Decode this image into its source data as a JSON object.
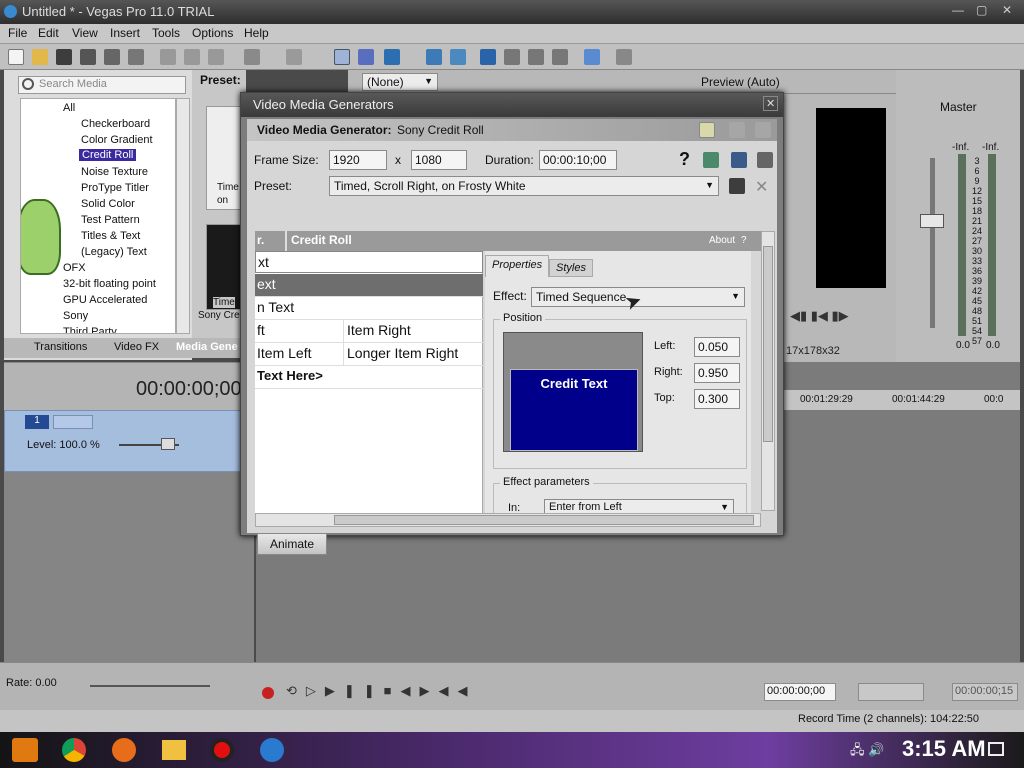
{
  "window": {
    "title": "Untitled * - Vegas Pro 11.0 TRIAL"
  },
  "menu": [
    "File",
    "Edit",
    "View",
    "Insert",
    "Tools",
    "Options",
    "Help"
  ],
  "explorer": {
    "search_placeholder": "Search Media",
    "preset_label": "Preset:",
    "tree": [
      "All",
      "Checkerboard",
      "Color Gradient",
      "Credit Roll",
      "Noise Texture",
      "ProType Titler",
      "Solid Color",
      "Test Pattern",
      "Titles & Text",
      "(Legacy) Text",
      "OFX",
      "32-bit floating point",
      "GPU Accelerated",
      "Sony",
      "Third Party"
    ],
    "selected": "Credit Roll",
    "thumb1_caption": "Time\non",
    "thumb2_caption": "Time",
    "thumb2_sub": "Sony Cre"
  },
  "window_tabs": [
    "Transitions",
    "Video FX",
    "Media Gene"
  ],
  "preview": {
    "preset": "(None)",
    "quality": "Preview (Auto)",
    "dims": "17x178x32"
  },
  "master": {
    "title": "Master",
    "meter_inf": "-Inf.",
    "scale": [
      "3",
      "6",
      "9",
      "12",
      "15",
      "18",
      "21",
      "24",
      "27",
      "30",
      "33",
      "36",
      "39",
      "42",
      "45",
      "48",
      "51",
      "54",
      "57"
    ],
    "zero": "0.0"
  },
  "timeline": {
    "timecode": "00:00:00;00",
    "level": "Level: 100.0 %",
    "ruler": [
      "00:01:29:29",
      "00:01:44:29",
      "00:0"
    ],
    "rate": "Rate: 0.00",
    "time_field": "00:00:00;00",
    "end_field": "00:00:00;15",
    "status": "Record Time (2 channels): 104:22:50"
  },
  "dialog": {
    "title": "Video Media Generators",
    "generator_label": "Video Media Generator:",
    "generator_value": "Sony Credit Roll",
    "frame_size_label": "Frame Size:",
    "width": "1920",
    "x": "x",
    "height": "1080",
    "duration_label": "Duration:",
    "duration": "00:00:10;00",
    "preset_label": "Preset:",
    "preset": "Timed, Scroll Right, on Frosty White",
    "plugin_title_prefix": "r.",
    "plugin_title": "Credit Roll",
    "about": "About",
    "help": "?",
    "list": [
      "xt",
      "ext",
      "n Text",
      "ft",
      "Item Left",
      "Text Here>"
    ],
    "list_right": {
      "3": "Item Right",
      "4": "Longer Item Right"
    },
    "tabs": [
      "Properties",
      "Styles"
    ],
    "effect_label": "Effect:",
    "effect": "Timed Sequence",
    "position_label": "Position",
    "preview_text": "Credit Text",
    "left_label": "Left:",
    "left": "0.050",
    "right_label": "Right:",
    "right": "0.950",
    "top_label": "Top:",
    "top": "0.300",
    "effect_params_label": "Effect parameters",
    "in_label": "In:",
    "in_value": "Enter from Left",
    "animate": "Animate"
  },
  "taskbar": {
    "clock": "3:15 AM"
  },
  "colors": {
    "accent_select": "#3a2aa0",
    "preview_blue": "#00008b",
    "track_header": "#a6bede"
  }
}
